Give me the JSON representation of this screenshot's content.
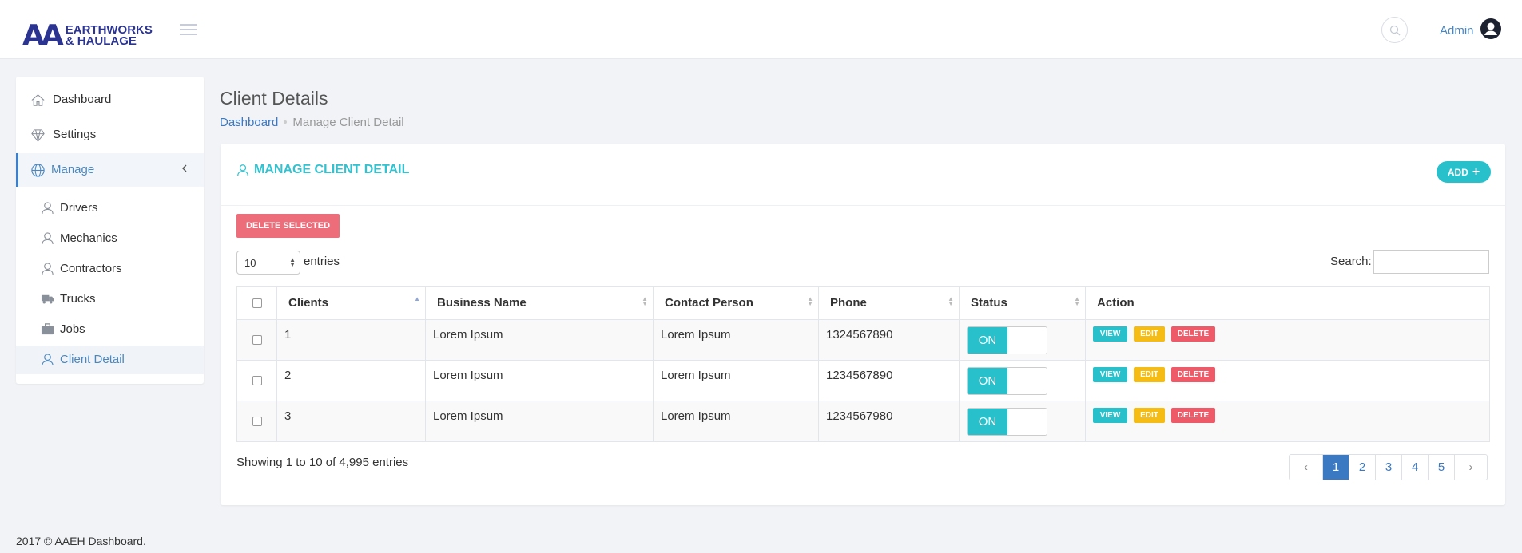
{
  "brand": {
    "logo_mark": "AA",
    "logo_line1": "EARTHWORKS",
    "logo_line2": "& HAULAGE"
  },
  "header": {
    "user": "Admin"
  },
  "sidebar": {
    "items": [
      {
        "label": "Dashboard",
        "icon": "home-icon"
      },
      {
        "label": "Settings",
        "icon": "diamond-icon"
      },
      {
        "label": "Manage",
        "icon": "globe-icon"
      }
    ],
    "sub_items": [
      {
        "label": "Drivers",
        "icon": "user-icon"
      },
      {
        "label": "Mechanics",
        "icon": "user-icon"
      },
      {
        "label": "Contractors",
        "icon": "user-icon"
      },
      {
        "label": "Trucks",
        "icon": "truck-icon"
      },
      {
        "label": "Jobs",
        "icon": "briefcase-icon"
      },
      {
        "label": "Client Detail",
        "icon": "user-icon"
      }
    ]
  },
  "page": {
    "title": "Client Details",
    "breadcrumb_home": "Dashboard",
    "breadcrumb_current": "Manage Client Detail"
  },
  "card": {
    "title": "MANAGE CLIENT DETAIL",
    "add_label": "ADD",
    "delete_selected": "DELETE SELECTED"
  },
  "table_controls": {
    "page_length": "10",
    "entries_label": "entries",
    "search_label": "Search:"
  },
  "table": {
    "headers": [
      "Clients",
      "Business Name",
      "Contact Person",
      "Phone",
      "Status",
      "Action"
    ],
    "rows": [
      {
        "client": "1",
        "business": "Lorem Ipsum",
        "contact": "Lorem Ipsum",
        "phone": "1324567890",
        "status": "ON"
      },
      {
        "client": "2",
        "business": "Lorem Ipsum",
        "contact": "Lorem Ipsum",
        "phone": "1234567890",
        "status": "ON"
      },
      {
        "client": "3",
        "business": "Lorem Ipsum",
        "contact": "Lorem Ipsum",
        "phone": "1234567980",
        "status": "ON"
      }
    ],
    "actions": {
      "view": "VIEW",
      "edit": "EDIT",
      "delete": "DELETE"
    }
  },
  "pagination": {
    "info": "Showing 1 to 10 of 4,995 entries",
    "prev": "‹",
    "pages": [
      "1",
      "2",
      "3",
      "4",
      "5"
    ],
    "next": "›",
    "current": "1"
  },
  "footer": {
    "text": "2017 © AAEH Dashboard."
  },
  "colors": {
    "accent": "#27c0cb",
    "primary": "#3b79c2",
    "danger": "#ee5a68",
    "warning": "#f4bc14",
    "brand": "#2b3490"
  }
}
